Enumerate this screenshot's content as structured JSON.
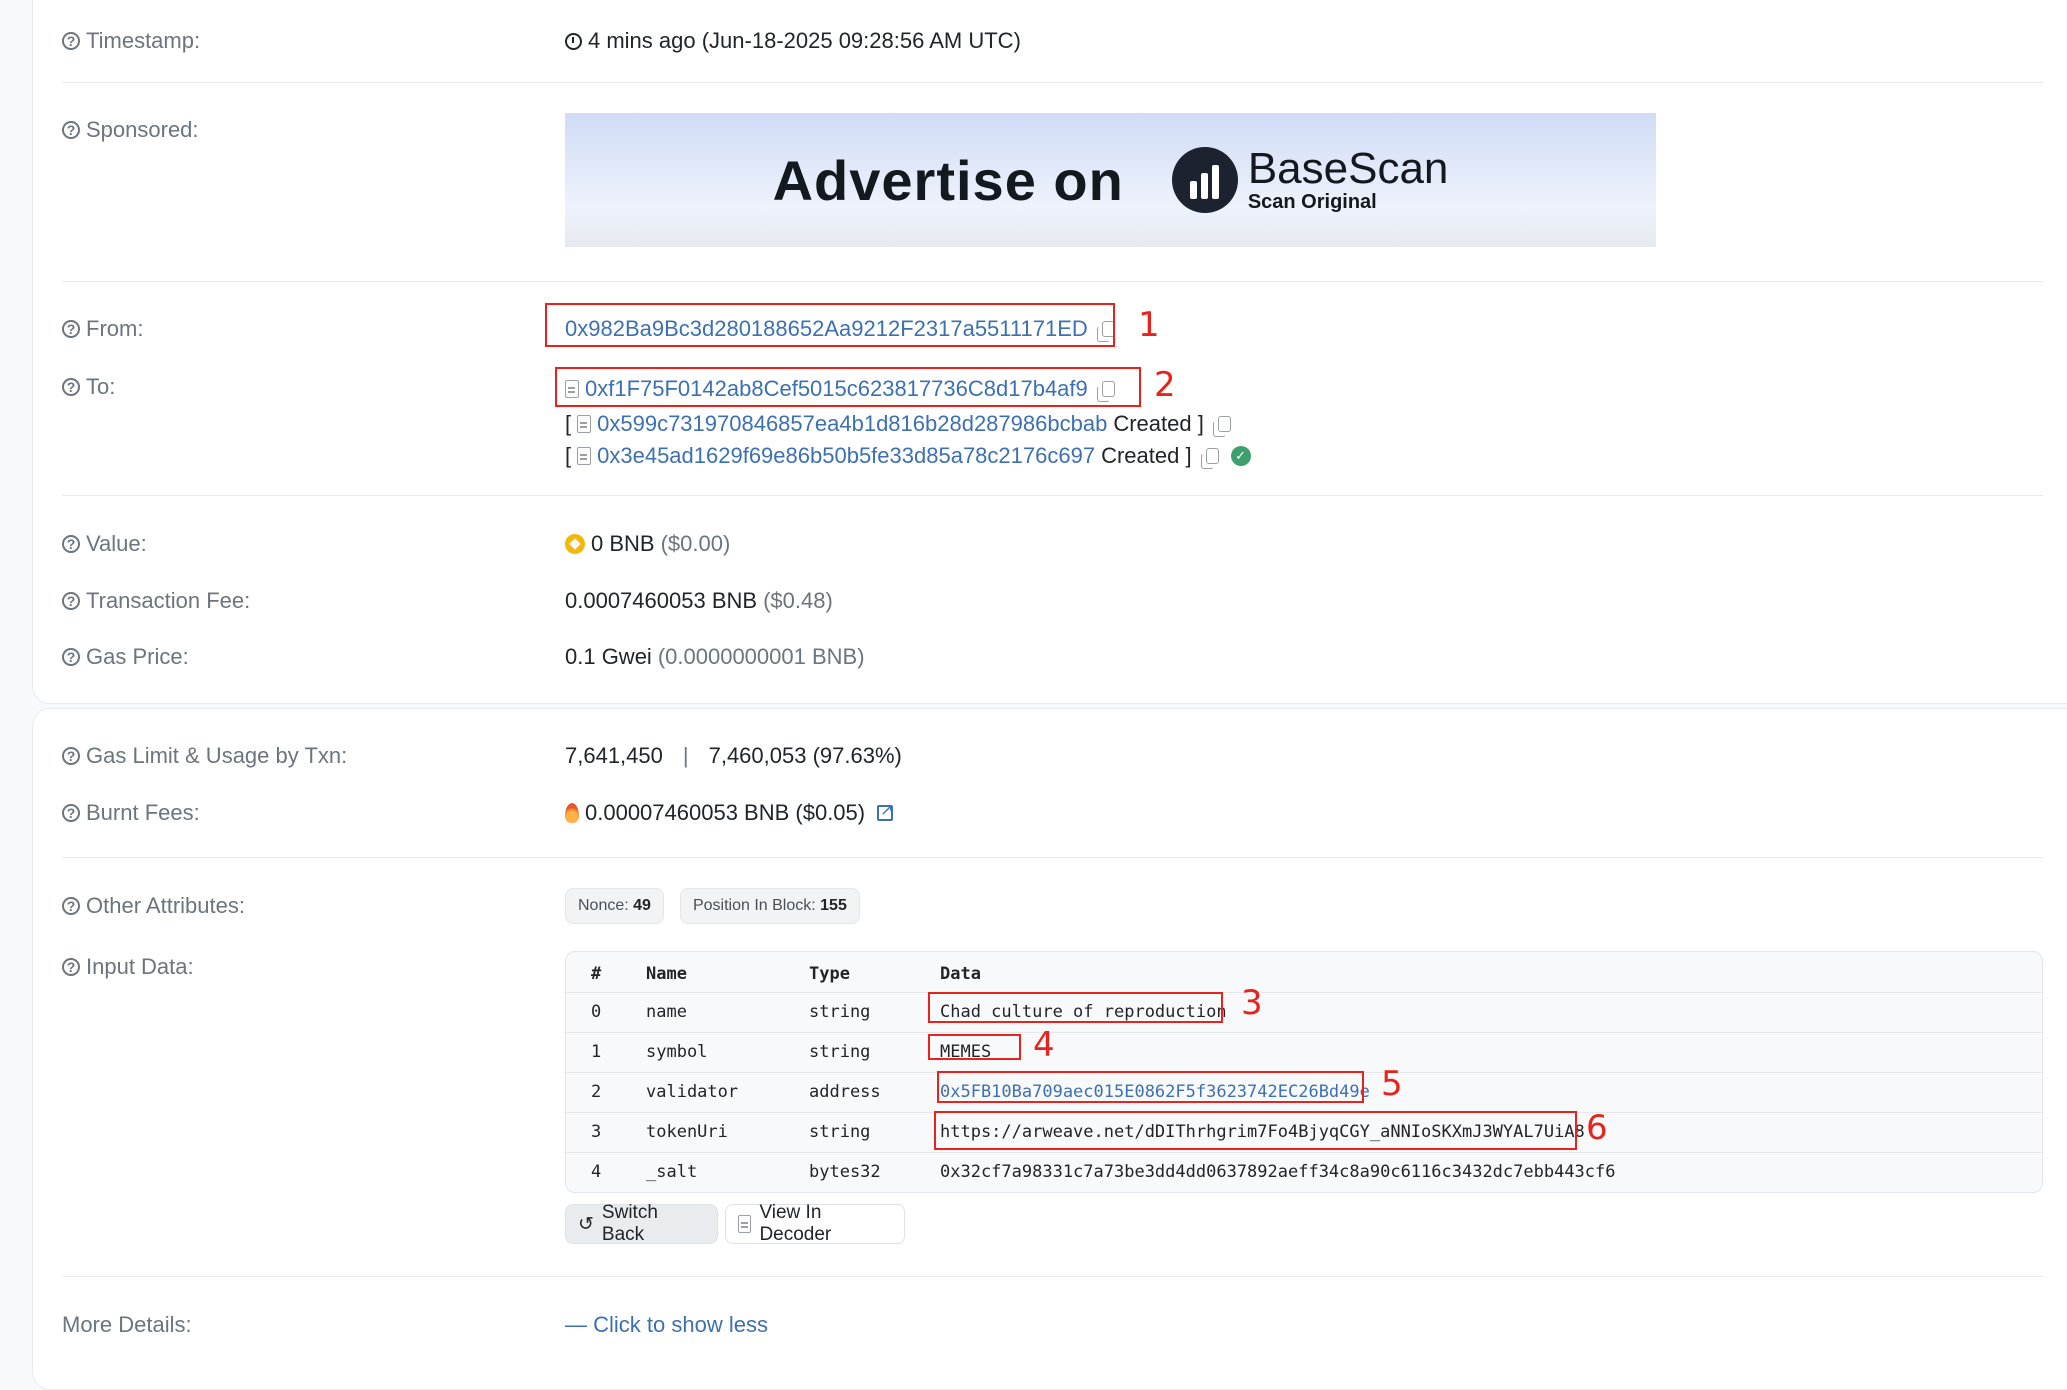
{
  "timestamp": {
    "label": "Timestamp:",
    "value": "4 mins ago (Jun-18-2025 09:28:56 AM UTC)"
  },
  "sponsored": {
    "label": "Sponsored:",
    "ad_text": "Advertise on",
    "ad_brand": "BaseScan",
    "ad_brand_sub": "Scan Original"
  },
  "from": {
    "label": "From:",
    "address": "0x982Ba9Bc3d280188652Aa9212F2317a5511171ED"
  },
  "to": {
    "label": "To:",
    "address": "0xf1F75F0142ab8Cef5015c623817736C8d17b4af9",
    "created": [
      {
        "open": "[",
        "address": "0x599c731970846857ea4b1d816b28d287986bcbab",
        "suffix": "Created ]"
      },
      {
        "open": "[",
        "address": "0x3e45ad1629f69e86b50b5fe33d85a78c2176c697",
        "suffix": "Created ]"
      }
    ]
  },
  "value": {
    "label": "Value:",
    "amount": "0 BNB",
    "usd": "($0.00)"
  },
  "tx_fee": {
    "label": "Transaction Fee:",
    "amount": "0.0007460053 BNB",
    "usd": "($0.48)"
  },
  "gas_price": {
    "label": "Gas Price:",
    "amount": "0.1 Gwei",
    "bnb": "(0.0000000001 BNB)"
  },
  "gas_limit": {
    "label": "Gas Limit & Usage by Txn:",
    "limit": "7,641,450",
    "sep": "|",
    "usage": "7,460,053 (97.63%)"
  },
  "burnt": {
    "label": "Burnt Fees:",
    "amount": "0.00007460053 BNB ($0.05)"
  },
  "other": {
    "label": "Other Attributes:",
    "nonce_label": "Nonce:",
    "nonce": "49",
    "pos_label": "Position In Block:",
    "pos": "155"
  },
  "input": {
    "label": "Input Data:",
    "headers": {
      "idx": "#",
      "name": "Name",
      "type": "Type",
      "data": "Data"
    },
    "rows": [
      {
        "idx": "0",
        "name": "name",
        "type": "string",
        "data": "Chad culture of reproduction"
      },
      {
        "idx": "1",
        "name": "symbol",
        "type": "string",
        "data": "MEMES"
      },
      {
        "idx": "2",
        "name": "validator",
        "type": "address",
        "data": "0x5FB10Ba709aec015E0862F5f3623742EC26Bd49e"
      },
      {
        "idx": "3",
        "name": "tokenUri",
        "type": "string",
        "data": "https://arweave.net/dDIThrhgrim7Fo4BjyqCGY_aNNIoSKXmJ3WYAL7UiA8"
      },
      {
        "idx": "4",
        "name": "_salt",
        "type": "bytes32",
        "data": "0x32cf7a98331c7a73be3dd4dd0637892aeff34c8a90c6116c3432dc7ebb443cf6"
      }
    ],
    "switch_back": "Switch Back",
    "view_decoder": "View In Decoder"
  },
  "more": {
    "label": "More Details:",
    "link": "— Click to show less"
  },
  "annotations": [
    "1",
    "2",
    "3",
    "4",
    "5",
    "6"
  ],
  "colors": {
    "link": "#3d70b2",
    "annotation": "#e8231d",
    "check": "#3fa06f",
    "bnb": "#f0b90b"
  }
}
